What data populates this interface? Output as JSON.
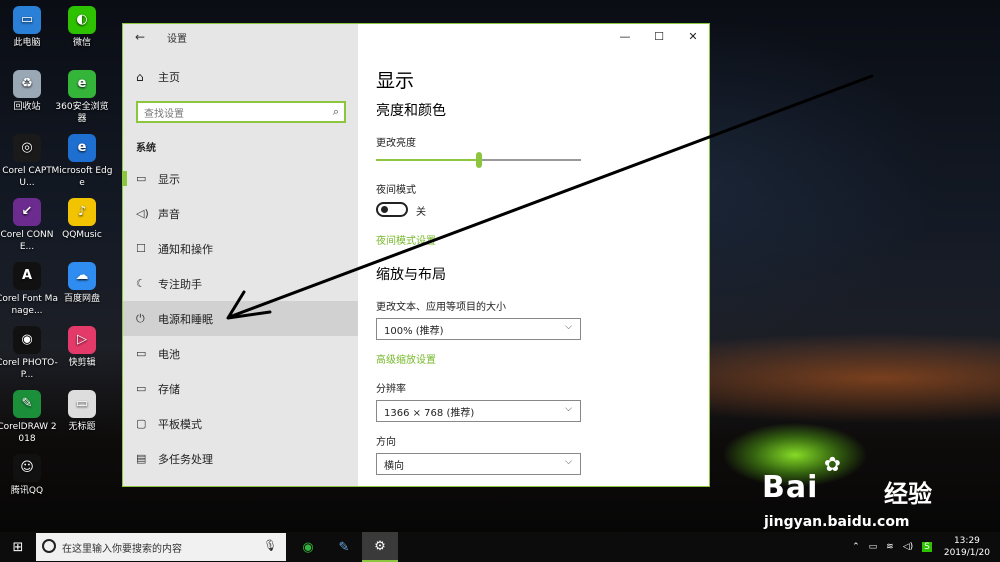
{
  "desktop": {
    "icons": [
      {
        "label": "此电脑",
        "color": "#2a7fd6",
        "glyph": "▭"
      },
      {
        "label": "微信",
        "color": "#2dc100",
        "glyph": "◐"
      },
      {
        "label": "回收站",
        "color": "#9aa7b5",
        "glyph": "♻"
      },
      {
        "label": "360安全浏览器",
        "color": "#35b43a",
        "glyph": "e"
      },
      {
        "label": "Corel CAPTU...",
        "color": "#1a1a1a",
        "glyph": "◎"
      },
      {
        "label": "Microsoft Edge",
        "color": "#1f6fd1",
        "glyph": "e"
      },
      {
        "label": "Corel CONNE...",
        "color": "#6b2b8f",
        "glyph": "↙"
      },
      {
        "label": "QQMusic",
        "color": "#f2c300",
        "glyph": "♪"
      },
      {
        "label": "Corel Font Manage...",
        "color": "#111111",
        "glyph": "A"
      },
      {
        "label": "百度网盘",
        "color": "#2f8cf0",
        "glyph": "☁"
      },
      {
        "label": "Corel PHOTO-P...",
        "color": "#111111",
        "glyph": "◉"
      },
      {
        "label": "快剪辑",
        "color": "#e43a6a",
        "glyph": "▷"
      },
      {
        "label": "CorelDRAW 2018",
        "color": "#1b8f3a",
        "glyph": "✎"
      },
      {
        "label": "无标题",
        "color": "#dddddd",
        "glyph": "▭"
      },
      {
        "label": "腾讯QQ",
        "color": "#111111",
        "glyph": "☺"
      }
    ]
  },
  "window": {
    "title": "设置",
    "back_icon": "←",
    "home_label": "主页",
    "search_placeholder": "查找设置",
    "section": "系统",
    "nav": [
      {
        "label": "显示",
        "icon": "▭",
        "icon_name": "display-icon"
      },
      {
        "label": "声音",
        "icon": "◁)",
        "icon_name": "sound-icon"
      },
      {
        "label": "通知和操作",
        "icon": "☐",
        "icon_name": "notification-icon"
      },
      {
        "label": "专注助手",
        "icon": "☾",
        "icon_name": "focus-assist-icon"
      },
      {
        "label": "电源和睡眠",
        "icon": "⏻",
        "icon_name": "power-icon"
      },
      {
        "label": "电池",
        "icon": "▭",
        "icon_name": "battery-icon"
      },
      {
        "label": "存储",
        "icon": "▭",
        "icon_name": "storage-icon"
      },
      {
        "label": "平板模式",
        "icon": "▢",
        "icon_name": "tablet-icon"
      },
      {
        "label": "多任务处理",
        "icon": "▤",
        "icon_name": "multitasking-icon"
      }
    ],
    "controls": {
      "minimize": "—",
      "maximize": "☐",
      "close": "✕"
    }
  },
  "content": {
    "heading": "显示",
    "brightness_section": "亮度和颜色",
    "brightness_label": "更改亮度",
    "brightness_level": 0.5,
    "night_mode_label": "夜间模式",
    "night_mode_state": "关",
    "night_mode_link": "夜间模式设置",
    "scale_section": "缩放与布局",
    "scale_label": "更改文本、应用等项目的大小",
    "scale_value": "100% (推荐)",
    "advanced_scale_link": "高级缩放设置",
    "resolution_label": "分辨率",
    "resolution_value": "1366 × 768 (推荐)",
    "orientation_label": "方向",
    "orientation_value": "横向"
  },
  "watermark": {
    "brand": "Bai",
    "brand_tail": "经验",
    "url": "jingyan.baidu.com"
  },
  "taskbar": {
    "search_placeholder": "在这里输入你要搜索的内容",
    "time": "13:29",
    "date": "2019/1/20",
    "ime": "S"
  }
}
